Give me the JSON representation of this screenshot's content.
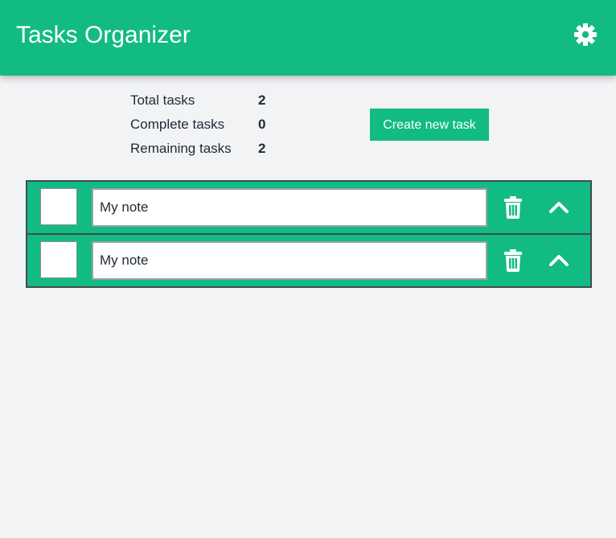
{
  "header": {
    "title": "Tasks Organizer",
    "settings_icon": "gear-icon"
  },
  "stats": [
    {
      "label": "Total tasks",
      "value": "2"
    },
    {
      "label": "Complete tasks",
      "value": "0"
    },
    {
      "label": "Remaining tasks",
      "value": "2"
    }
  ],
  "actions": {
    "create_label": "Create new task"
  },
  "tasks": [
    {
      "text": "My note",
      "checked": false
    },
    {
      "text": "My note",
      "checked": false
    }
  ],
  "icons": {
    "delete": "trash-icon",
    "collapse": "chevron-up-icon"
  },
  "colors": {
    "accent": "#12bb82",
    "background": "#f2f3f5",
    "text": "#1f2a36",
    "border": "#414b56"
  }
}
